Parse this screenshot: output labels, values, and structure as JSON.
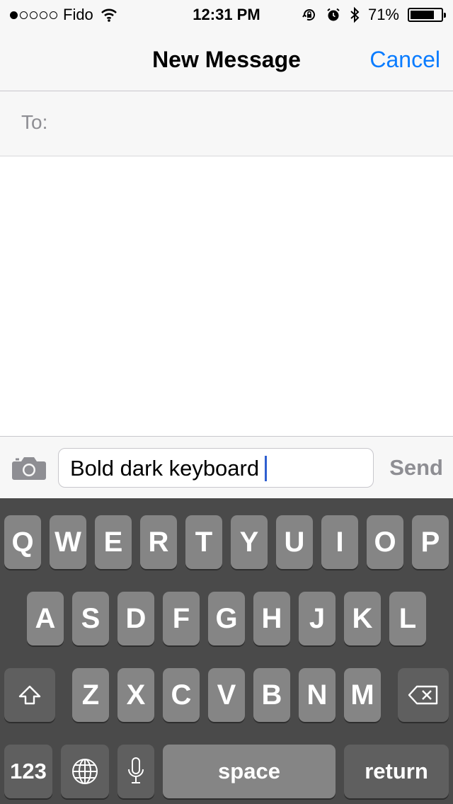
{
  "status_bar": {
    "carrier": "Fido",
    "signal_bars_filled": 1,
    "signal_bars_total": 5,
    "time": "12:31 PM",
    "battery_percent": "71%",
    "icons": [
      "wifi-icon",
      "rotation-lock-icon",
      "alarm-icon",
      "bluetooth-icon",
      "battery-icon"
    ]
  },
  "nav": {
    "title": "New Message",
    "cancel_label": "Cancel",
    "accent_color": "#0a7cff"
  },
  "recipient": {
    "label": "To:",
    "value": ""
  },
  "compose": {
    "text": "Bold dark keyboard",
    "send_label": "Send"
  },
  "keyboard": {
    "row1": [
      "Q",
      "W",
      "E",
      "R",
      "T",
      "Y",
      "U",
      "I",
      "O",
      "P"
    ],
    "row2": [
      "A",
      "S",
      "D",
      "F",
      "G",
      "H",
      "J",
      "K",
      "L"
    ],
    "row3": [
      "Z",
      "X",
      "C",
      "V",
      "B",
      "N",
      "M"
    ],
    "numbers_label": "123",
    "space_label": "space",
    "return_label": "return",
    "shift_icon": "shift-icon",
    "delete_icon": "delete-icon",
    "globe_icon": "globe-icon",
    "mic_icon": "microphone-icon"
  }
}
